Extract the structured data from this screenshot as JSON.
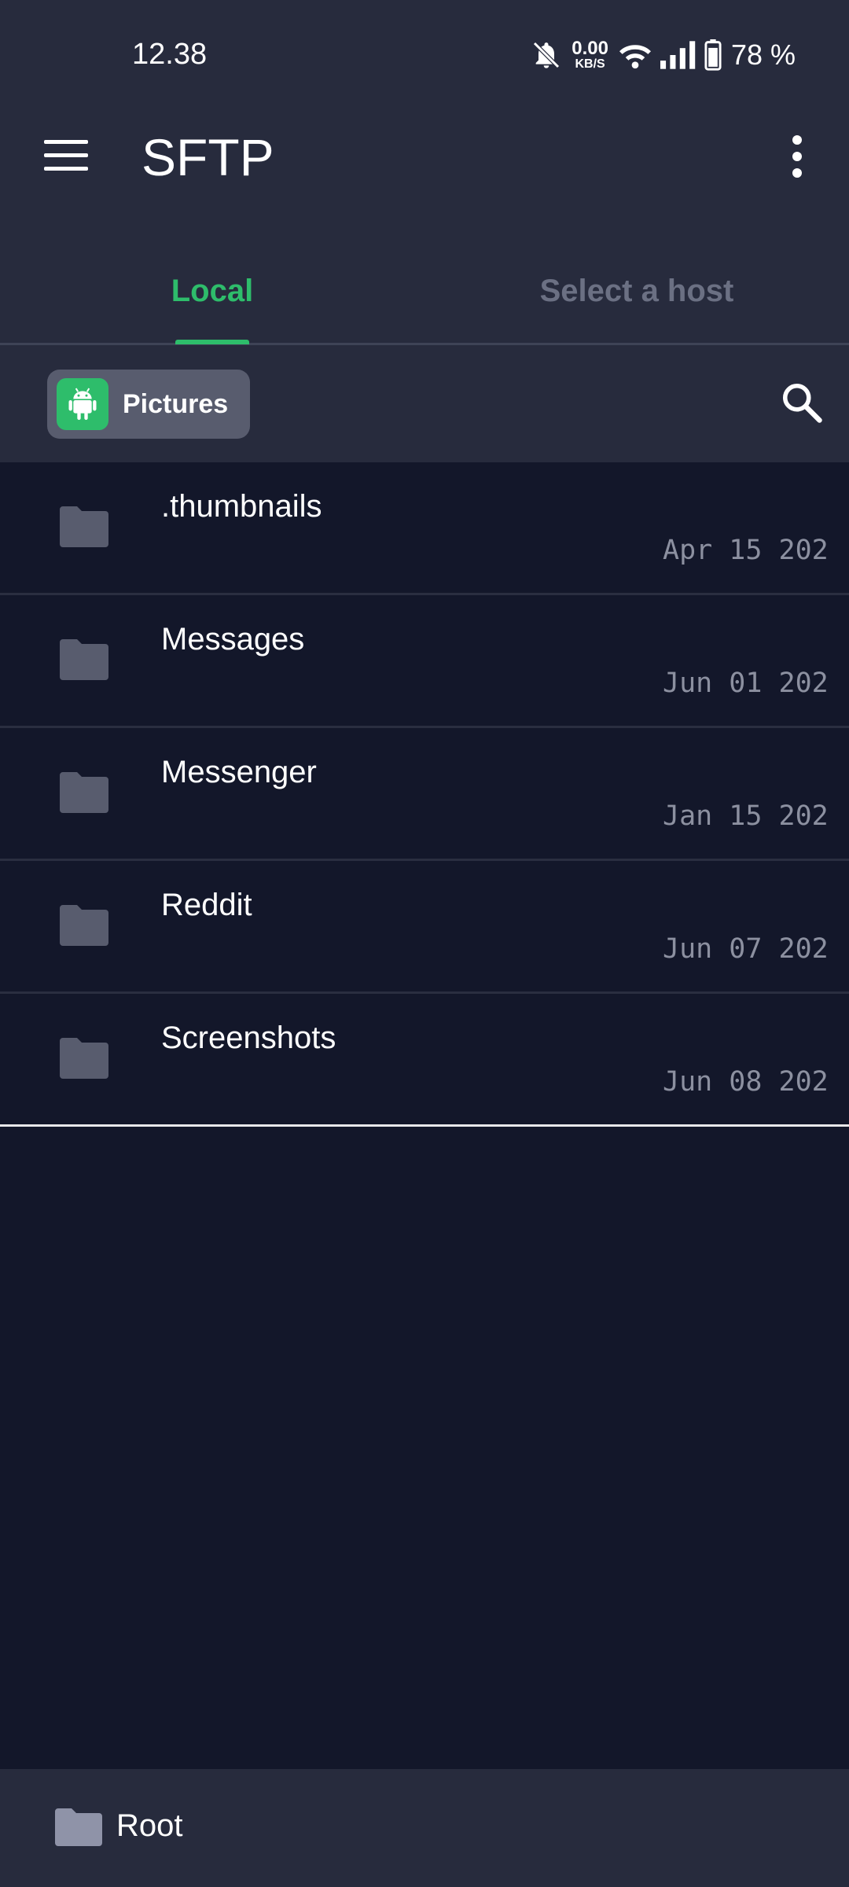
{
  "status_bar": {
    "time": "12.38",
    "net_speed_value": "0.00",
    "net_speed_unit": "KB/S",
    "battery": "78 %"
  },
  "app_bar": {
    "title": "SFTP"
  },
  "tabs": [
    {
      "label": "Local",
      "selected": true
    },
    {
      "label": "Select a host",
      "selected": false
    }
  ],
  "path": {
    "current": "Pictures"
  },
  "files": [
    {
      "name": ".thumbnails",
      "date": "Apr 15 202"
    },
    {
      "name": "Messages",
      "date": "Jun 01 202"
    },
    {
      "name": "Messenger",
      "date": "Jan 15 202"
    },
    {
      "name": "Reddit",
      "date": "Jun 07 202"
    },
    {
      "name": "Screenshots",
      "date": "Jun 08 202"
    }
  ],
  "bottom_bar": {
    "root_label": "Root"
  },
  "colors": {
    "accent": "#2ebd6b",
    "header_bg": "#272b3d",
    "list_bg": "#13172a",
    "folder": "#585c6e",
    "date_text": "#8c90a0"
  },
  "icons": {
    "menu": "hamburger-menu-icon",
    "more": "more-vertical-icon",
    "search": "search-icon",
    "folder": "folder-icon",
    "android": "android-icon",
    "mute": "bell-off-icon",
    "wifi": "wifi-icon",
    "signal": "signal-icon",
    "battery": "battery-icon"
  }
}
